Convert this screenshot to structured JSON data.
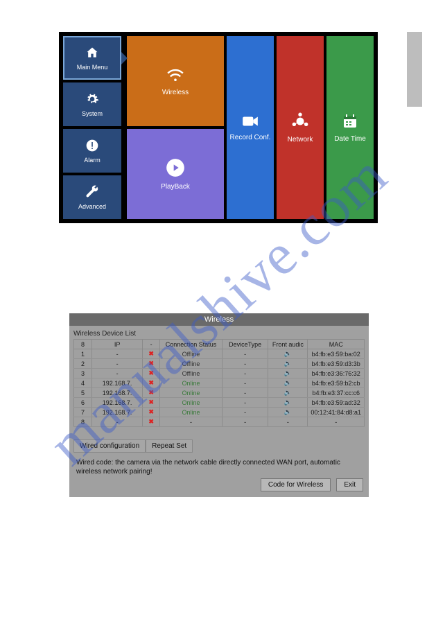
{
  "watermark": "manualshive.com",
  "main_menu": {
    "sidebar": [
      {
        "label": "Main Menu",
        "icon": "home",
        "selected": true
      },
      {
        "label": "System",
        "icon": "gear"
      },
      {
        "label": "Alarm",
        "icon": "alert"
      },
      {
        "label": "Advanced",
        "icon": "wrench"
      }
    ],
    "tiles": {
      "wireless": {
        "label": "Wireless"
      },
      "playback": {
        "label": "PlayBack"
      },
      "record": {
        "label": "Record Conf."
      },
      "network": {
        "label": "Network"
      },
      "datetime": {
        "label": "Date Time"
      }
    }
  },
  "wireless_panel": {
    "title": "Wireless",
    "list_label": "Wireless Device List",
    "headers": {
      "count": "8",
      "ip": "IP",
      "del": "-",
      "status": "Connection Status",
      "type": "DeviceType",
      "audio": "Front audic",
      "mac": "MAC"
    },
    "rows": [
      {
        "n": "1",
        "ip": "-",
        "del": "x",
        "status": "Offline",
        "type": "-",
        "audio": "blue",
        "mac": "b4:fb:e3:59:ba:02"
      },
      {
        "n": "2",
        "ip": "-",
        "del": "x",
        "status": "Offline",
        "type": "-",
        "audio": "blue",
        "mac": "b4:fb:e3:59:d3:3b"
      },
      {
        "n": "3",
        "ip": "-",
        "del": "x",
        "status": "Offline",
        "type": "-",
        "audio": "blue",
        "mac": "b4:fb:e3:36:76:32"
      },
      {
        "n": "4",
        "ip": "192.168.7.",
        "del": "x",
        "status": "Online",
        "type": "-",
        "audio": "blue",
        "mac": "b4:fb:e3:59:b2:cb"
      },
      {
        "n": "5",
        "ip": "192.168.7.",
        "del": "x",
        "status": "Online",
        "type": "-",
        "audio": "blue",
        "mac": "b4:fb:e3:37:cc:c6"
      },
      {
        "n": "6",
        "ip": "192.168.7.",
        "del": "x",
        "status": "Online",
        "type": "-",
        "audio": "red",
        "mac": "b4:fb:e3:59:ad:32"
      },
      {
        "n": "7",
        "ip": "192.168.7.",
        "del": "x",
        "status": "Online",
        "type": "-",
        "audio": "blue",
        "mac": "00:12:41:84:d8:a1"
      },
      {
        "n": "8",
        "ip": "-",
        "del": "x",
        "status": "-",
        "type": "-",
        "audio": "-",
        "mac": "-"
      }
    ],
    "tabs": {
      "wired": "Wired configuration",
      "repeat": "Repeat Set"
    },
    "info_text": "Wired code: the camera via the network cable directly connected WAN port, automatic wireless network pairing!",
    "buttons": {
      "code": "Code for Wireless",
      "exit": "Exit"
    }
  }
}
